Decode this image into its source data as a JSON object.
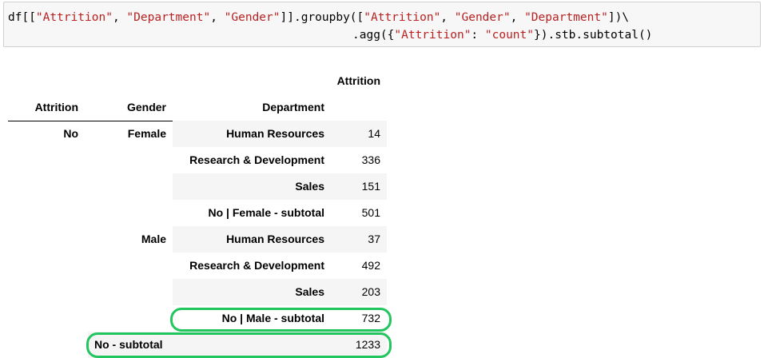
{
  "code": {
    "line1_parts": [
      {
        "t": "df[[",
        "s": false
      },
      {
        "t": "\"Attrition\"",
        "s": true
      },
      {
        "t": ", ",
        "s": false
      },
      {
        "t": "\"Department\"",
        "s": true
      },
      {
        "t": ", ",
        "s": false
      },
      {
        "t": "\"Gender\"",
        "s": true
      },
      {
        "t": "]].groupby([",
        "s": false
      },
      {
        "t": "\"Attrition\"",
        "s": true
      },
      {
        "t": ", ",
        "s": false
      },
      {
        "t": "\"Gender\"",
        "s": true
      },
      {
        "t": ", ",
        "s": false
      },
      {
        "t": "\"Department\"",
        "s": true
      },
      {
        "t": "])\\",
        "s": false
      }
    ],
    "line2_parts": [
      {
        "t": ".agg({",
        "s": false
      },
      {
        "t": "\"Attrition\"",
        "s": true
      },
      {
        "t": ": ",
        "s": false
      },
      {
        "t": "\"count\"",
        "s": true
      },
      {
        "t": "}).stb.subtotal()",
        "s": false
      }
    ]
  },
  "table": {
    "value_column_header": "Attrition",
    "index_headers": [
      "Attrition",
      "Gender",
      "Department"
    ],
    "rows": [
      {
        "attrition": "No",
        "gender": "Female",
        "department": "Human Resources",
        "value": "14"
      },
      {
        "attrition": "",
        "gender": "",
        "department": "Research & Development",
        "value": "336"
      },
      {
        "attrition": "",
        "gender": "",
        "department": "Sales",
        "value": "151"
      },
      {
        "attrition": "",
        "gender": "",
        "department": "No | Female - subtotal",
        "value": "501"
      },
      {
        "attrition": "",
        "gender": "Male",
        "department": "Human Resources",
        "value": "37"
      },
      {
        "attrition": "",
        "gender": "",
        "department": "Research & Development",
        "value": "492"
      },
      {
        "attrition": "",
        "gender": "",
        "department": "Sales",
        "value": "203"
      },
      {
        "attrition": "",
        "gender": "",
        "department": "No | Male - subtotal",
        "value": "732"
      }
    ],
    "total_row": {
      "label": "No - subtotal",
      "value": "1233"
    }
  },
  "colors": {
    "highlight": "#22c55e",
    "string": "#ba2121",
    "stripe": "#f5f5f5"
  }
}
